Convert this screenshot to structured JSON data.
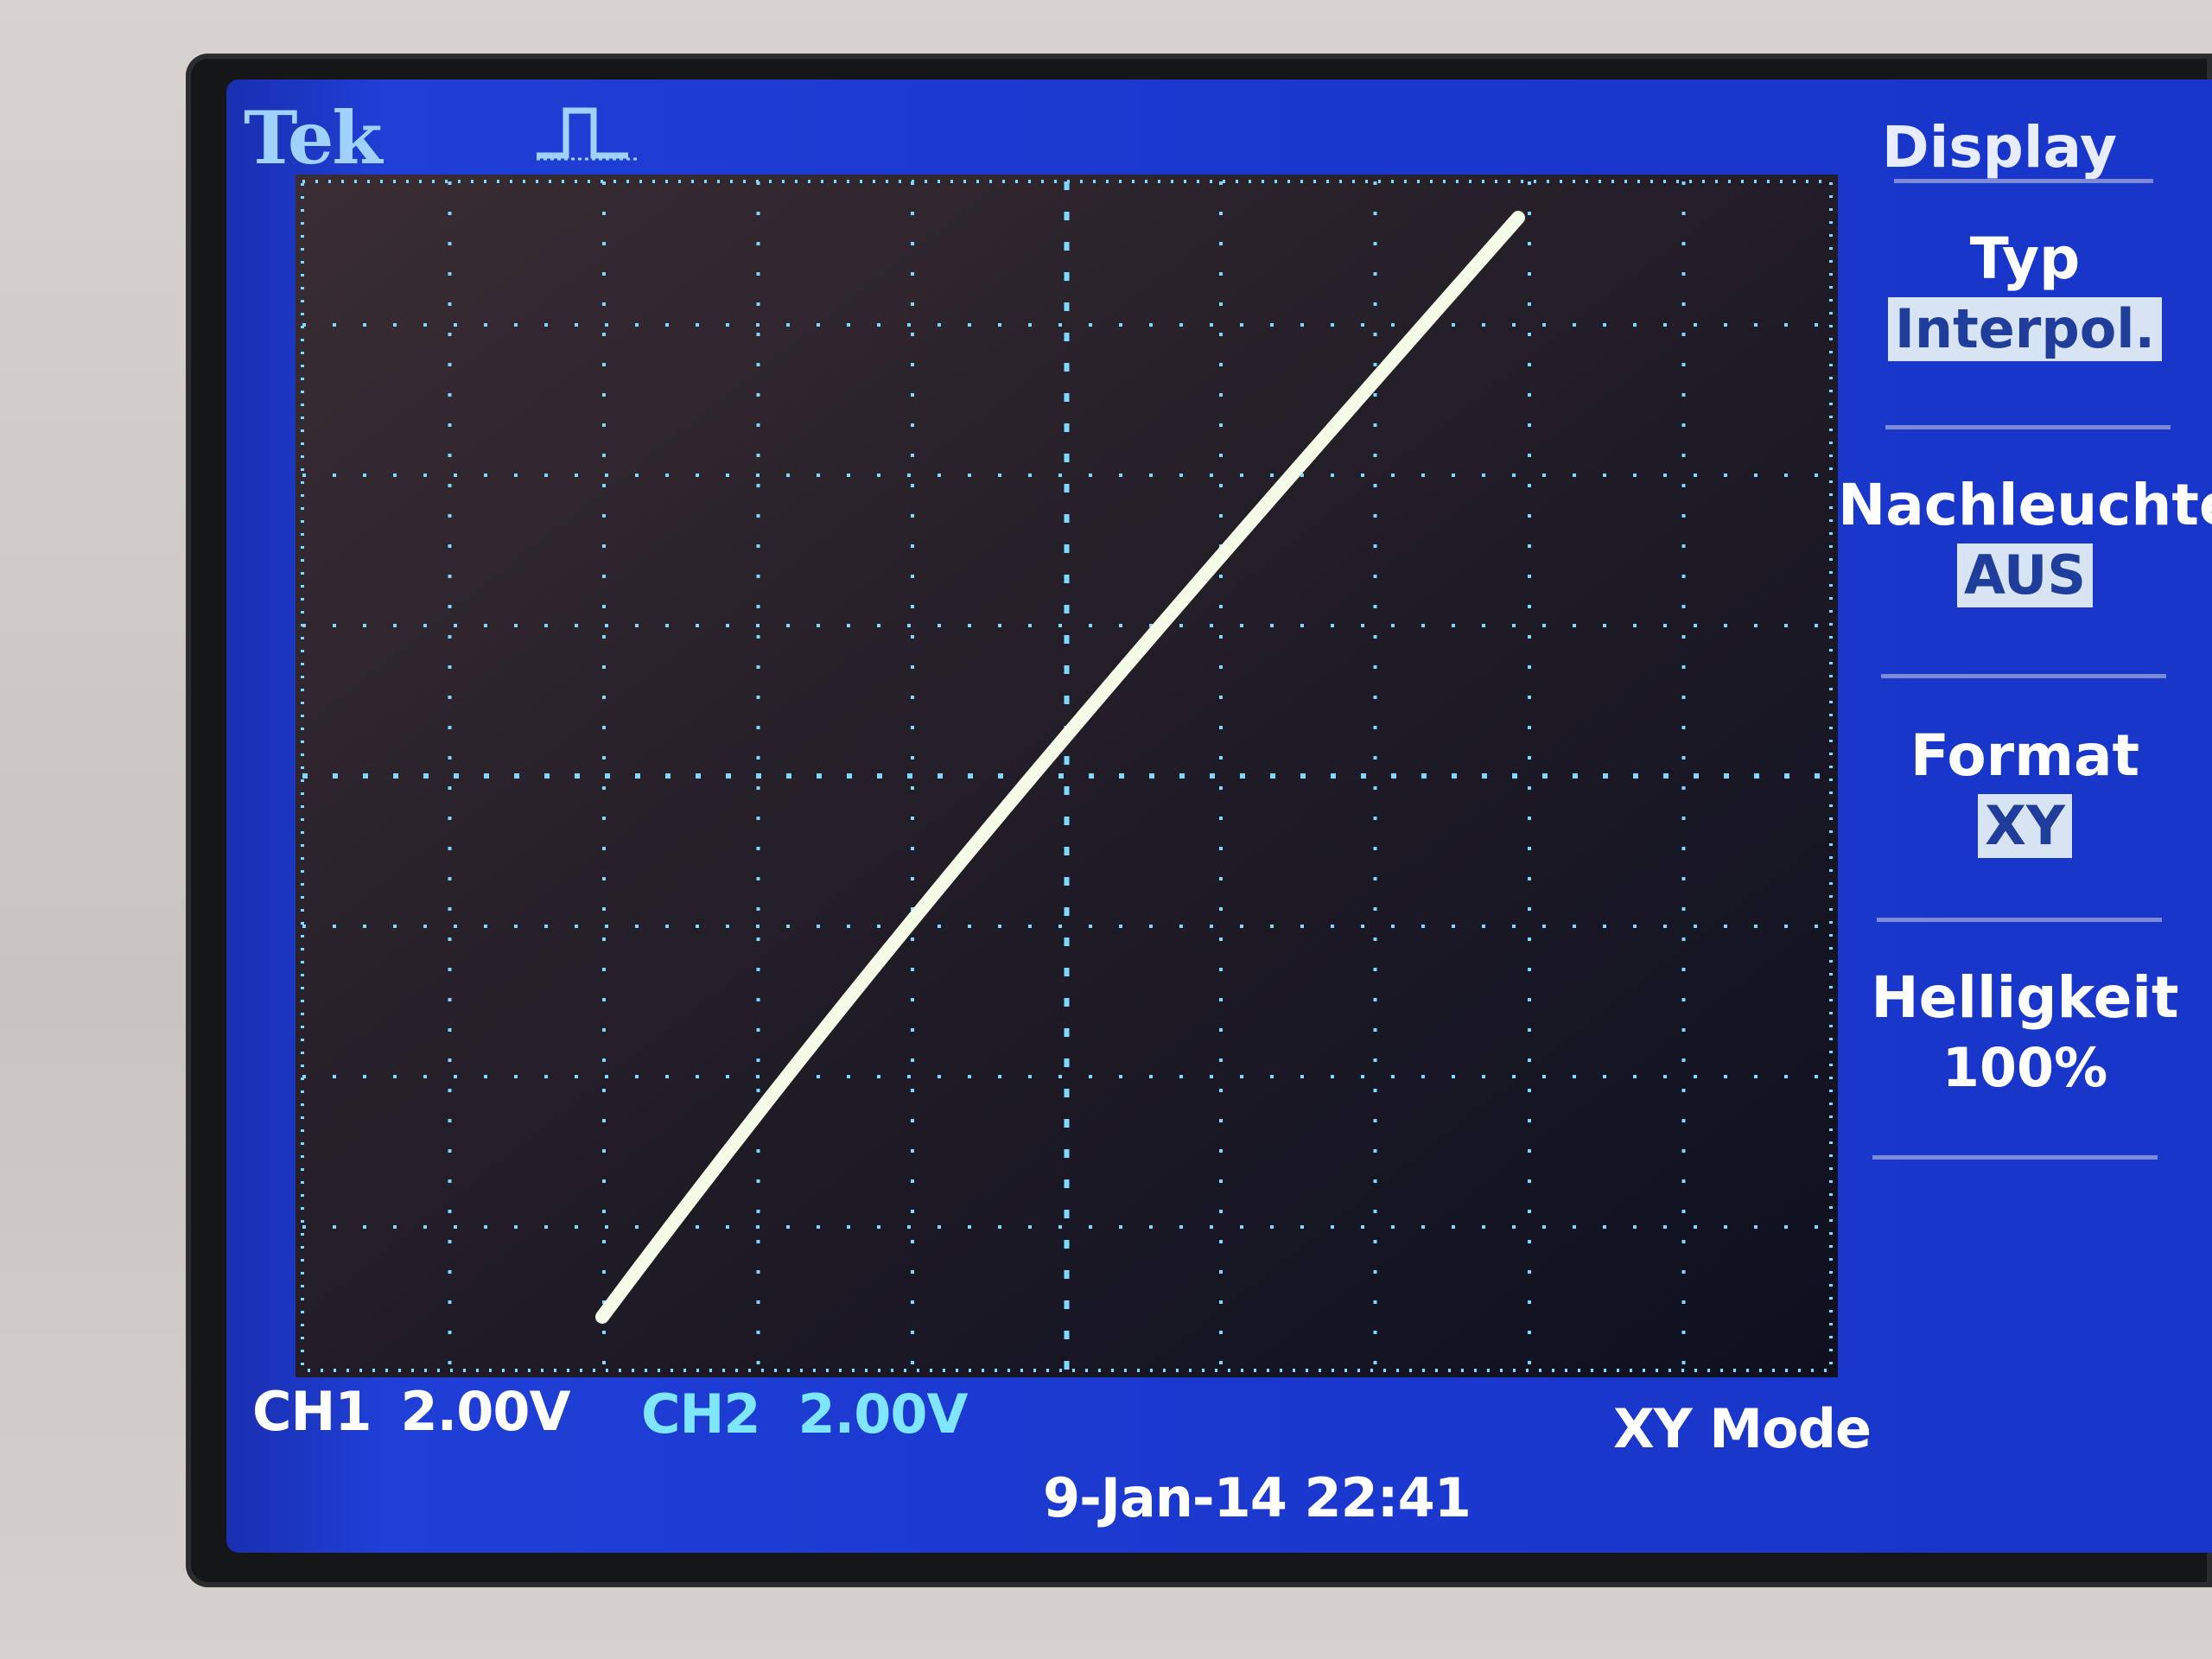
{
  "brand": "Tek",
  "menu": {
    "title": "Display",
    "items": [
      {
        "label": "Typ",
        "value": "Interpol."
      },
      {
        "label": "Nachleuchten",
        "value": "AUS"
      },
      {
        "label": "Format",
        "value": "XY"
      },
      {
        "label": "Helligkeit",
        "value": "100%"
      }
    ]
  },
  "status": {
    "ch1_label": "CH1",
    "ch1_scale": "2.00V",
    "ch2_label": "CH2",
    "ch2_scale": "2.00V",
    "mode": "XY Mode",
    "datetime": "9-Jan-14 22:41"
  },
  "colors": {
    "screen_blue": "#1b38cf",
    "trace": "#f4fbe6",
    "grid_dots": "#7fd8ff"
  },
  "icons": {
    "trigger": "pulse-trigger-icon"
  }
}
